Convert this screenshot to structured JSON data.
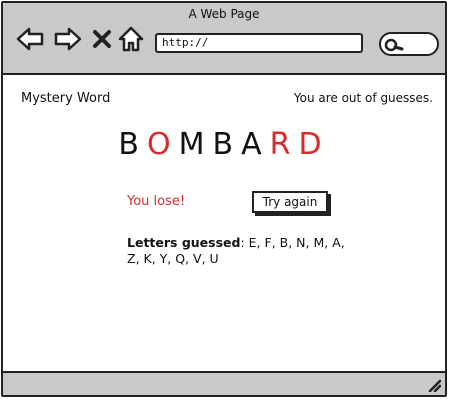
{
  "window": {
    "title": "A Web Page"
  },
  "toolbar": {
    "icons": [
      "back-arrow-icon",
      "forward-arrow-icon",
      "close-icon",
      "home-icon",
      "search-icon"
    ],
    "url": "http://"
  },
  "game": {
    "app_label": "Mystery Word",
    "status": "You are out of guesses.",
    "word_letters": [
      {
        "char": "B",
        "color": "#111111"
      },
      {
        "char": "O",
        "color": "#d92b2b"
      },
      {
        "char": "M",
        "color": "#111111"
      },
      {
        "char": "B",
        "color": "#111111"
      },
      {
        "char": "A",
        "color": "#111111"
      },
      {
        "char": "R",
        "color": "#d92b2b"
      },
      {
        "char": "D",
        "color": "#d92b2b"
      }
    ],
    "result_text": "You lose!",
    "result_color": "#d92b2b",
    "try_again_label": "Try again",
    "letters_guessed_label": "Letters guessed",
    "letters_guessed_value": ": E, F, B, N, M, A, Z, K, Y, Q, V, U"
  }
}
